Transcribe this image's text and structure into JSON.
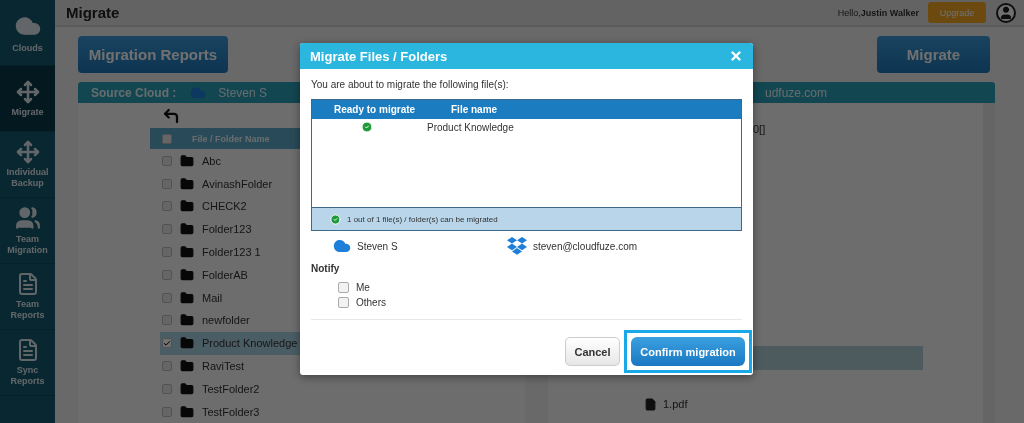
{
  "sidebar": {
    "items": [
      {
        "label": "Clouds",
        "kind": "cloud",
        "selected": false
      },
      {
        "label": "Migrate",
        "kind": "move",
        "selected": true
      },
      {
        "label": "Individual Backup",
        "kind": "move",
        "selected": false
      },
      {
        "label": "Team Migration",
        "kind": "team",
        "selected": false
      },
      {
        "label": "Team Reports",
        "kind": "report",
        "selected": false
      },
      {
        "label": "Sync Reports",
        "kind": "report",
        "selected": false
      }
    ]
  },
  "header": {
    "title": "Migrate",
    "greeting": "Hello,",
    "user": "Justin Walker",
    "upgrade": "Upgrade"
  },
  "actions": {
    "reports": "Migration Reports",
    "migrate": "Migrate"
  },
  "source": {
    "label": "Source Cloud :",
    "account": "Steven S",
    "column": "File / Folder Name",
    "all_checked": false,
    "rows": [
      {
        "name": "Abc",
        "checked": false
      },
      {
        "name": "AvinashFolder",
        "checked": false
      },
      {
        "name": "CHECK2",
        "checked": false
      },
      {
        "name": "Folder123",
        "checked": false
      },
      {
        "name": "Folder123 1",
        "checked": false
      },
      {
        "name": "FolderAB",
        "checked": false
      },
      {
        "name": "Mail",
        "checked": false
      },
      {
        "name": "newfolder",
        "checked": false
      },
      {
        "name": "Product Knowledge",
        "checked": true
      },
      {
        "name": "RaviTest",
        "checked": false
      },
      {
        "name": "TestFolder2",
        "checked": false
      },
      {
        "name": "TestFolder3",
        "checked": false
      }
    ]
  },
  "destination": {
    "account": "udfuze.com",
    "rows": [
      {
        "kind": "text",
        "name": "0[]",
        "selected": false
      },
      {
        "kind": "blank",
        "selected": true
      },
      {
        "kind": "file",
        "name": "1.pdf",
        "selected": false
      }
    ]
  },
  "dialog": {
    "title": "Migrate Files / Folders",
    "intro": "You are about to migrate the following file(s):",
    "columns": [
      "Ready to migrate",
      "File name"
    ],
    "rows": [
      {
        "ready": true,
        "name": "Product Knowledge"
      }
    ],
    "summary": "1 out of 1 file(s) / folder(s) can be migrated",
    "source": "Steven S",
    "destination": "steven@cloudfuze.com",
    "notify": {
      "label": "Notify",
      "options": [
        {
          "label": "Me",
          "checked": false
        },
        {
          "label": "Others",
          "checked": false
        }
      ]
    },
    "cancel": "Cancel",
    "confirm": "Confirm migration",
    "confirm_highlighted": true
  }
}
